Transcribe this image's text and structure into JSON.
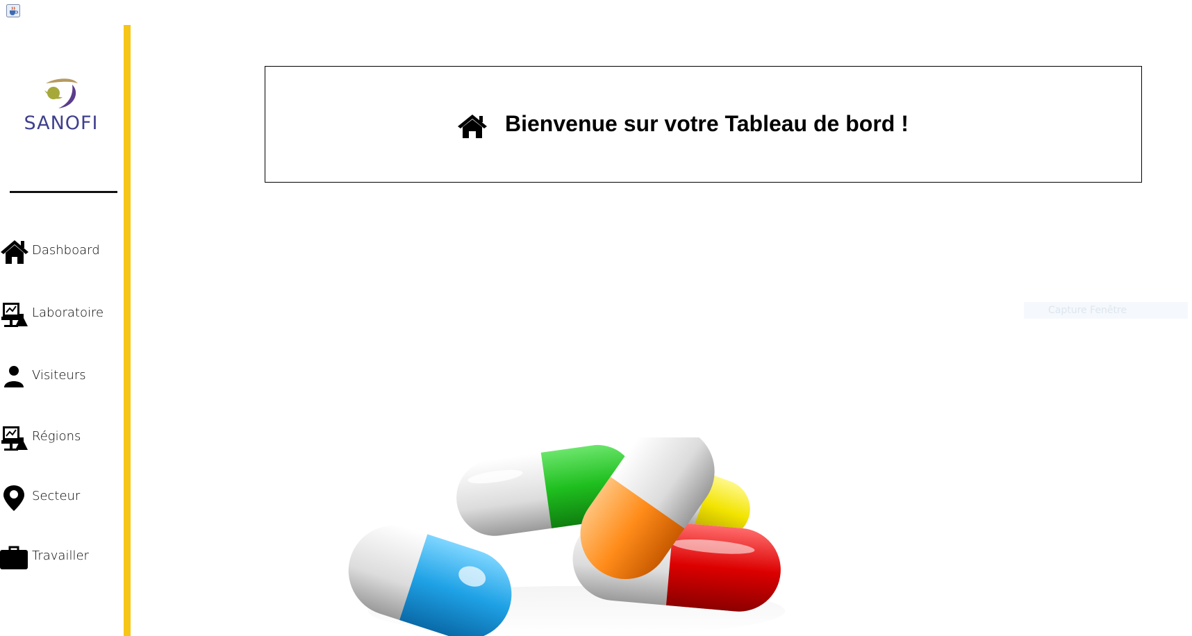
{
  "window": {
    "title_icon": "java-cup-icon"
  },
  "colors": {
    "accent": "#f5c518",
    "logo_text": "#3f3f8f",
    "logo_olive": "#a6a83a",
    "logo_purple": "#5a3c8c"
  },
  "logo": {
    "text": "SANOFI",
    "icon": "sanofi-bird-icon"
  },
  "sidebar": {
    "items": [
      {
        "label": "Dashboard",
        "icon": "home-icon"
      },
      {
        "label": "Laboratoire",
        "icon": "lab-icon"
      },
      {
        "label": "Visiteurs",
        "icon": "user-icon"
      },
      {
        "label": "Régions",
        "icon": "lab-icon"
      },
      {
        "label": "Secteur",
        "icon": "map-pin-icon"
      },
      {
        "label": "Travailler",
        "icon": "briefcase-icon"
      }
    ]
  },
  "main": {
    "welcome": {
      "title": "Bienvenue sur votre Tableau de bord !",
      "icon": "home-icon"
    },
    "watermark": "Capture Fenêtre",
    "illustration": "pills-illustration"
  }
}
